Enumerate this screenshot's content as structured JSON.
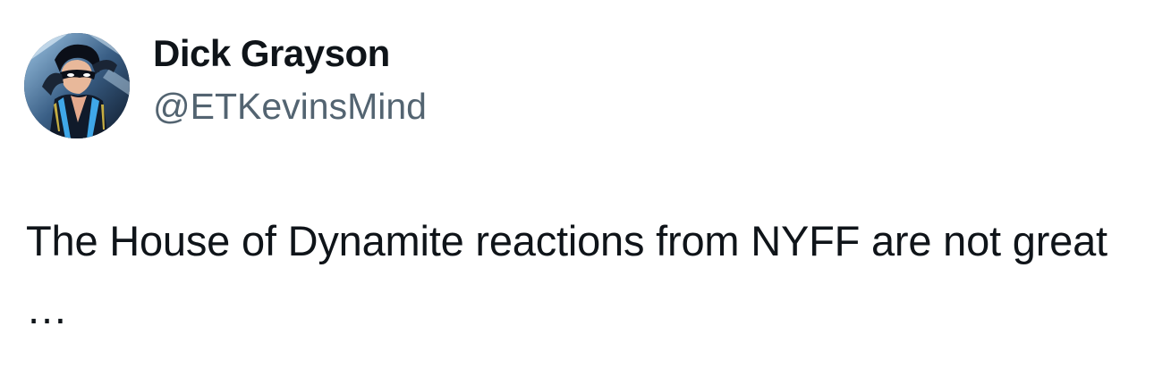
{
  "author": {
    "display_name": "Dick Grayson",
    "handle": "@ETKevinsMind",
    "avatar_icon": "comic-hero-avatar"
  },
  "tweet": {
    "text": "The House of Dynamite reactions from NYFF are not great …"
  },
  "colors": {
    "text_primary": "#0f1419",
    "text_secondary": "#536471",
    "background": "#ffffff"
  }
}
